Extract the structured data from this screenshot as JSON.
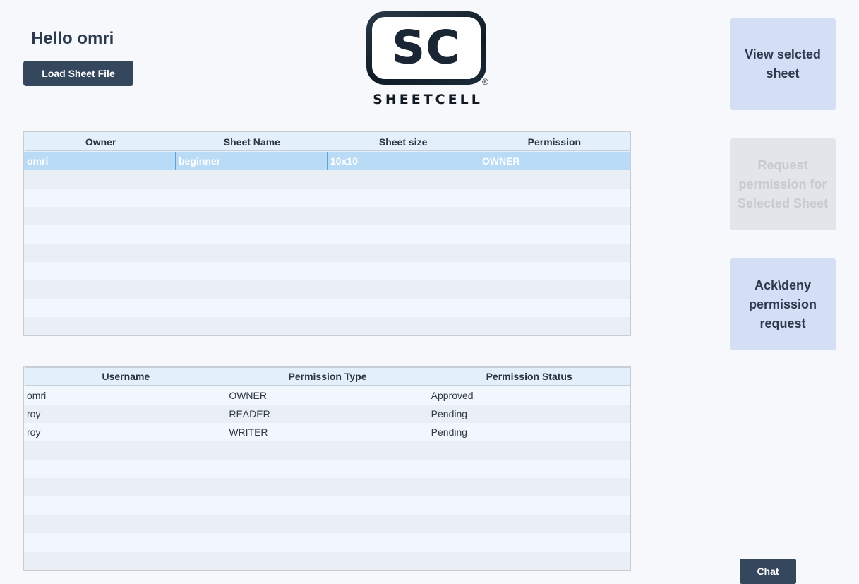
{
  "header": {
    "greeting": "Hello omri",
    "load_button": "Load Sheet File",
    "logo_letters": "SC",
    "logo_registered": "®",
    "logo_name": "SHEETCELL"
  },
  "sheets_table": {
    "columns": [
      "Owner",
      "Sheet Name",
      "Sheet size",
      "Permission"
    ],
    "rows": [
      {
        "owner": "omri",
        "name": "beginner",
        "size": "10x10",
        "permission": "OWNER",
        "selected": true
      }
    ]
  },
  "permissions_table": {
    "columns": [
      "Username",
      "Permission Type",
      "Permission Status"
    ],
    "rows": [
      {
        "username": "omri",
        "type": "OWNER",
        "status": "Approved"
      },
      {
        "username": "roy",
        "type": "READER",
        "status": "Pending"
      },
      {
        "username": "roy",
        "type": "WRITER",
        "status": "Pending"
      }
    ]
  },
  "side_buttons": {
    "view": "View selcted sheet",
    "request": "Request permission for Selected Sheet",
    "ack": "Ack\\deny permission request"
  },
  "chat_button": "Chat",
  "colors": {
    "background": "#f7f8fc",
    "dark_button": "#34475c",
    "side_button": "#d4dff6",
    "side_button_disabled": "#e2e5ea",
    "selected_row": "#b9dbf5"
  }
}
